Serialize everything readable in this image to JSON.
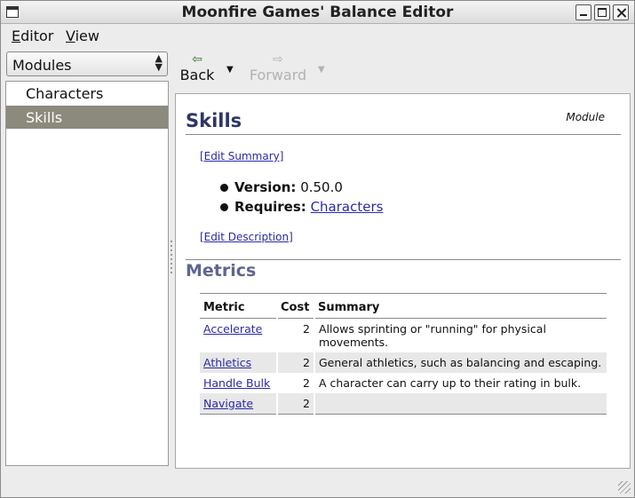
{
  "window": {
    "title": "Moonfire Games' Balance Editor"
  },
  "menubar": {
    "items": [
      {
        "label_u": "E",
        "label_rest": "ditor"
      },
      {
        "label_u": "V",
        "label_rest": "iew"
      }
    ]
  },
  "sidebar": {
    "select": {
      "value": "Modules"
    },
    "items": [
      {
        "label": "Characters",
        "selected": false
      },
      {
        "label": "Skills",
        "selected": true
      }
    ]
  },
  "toolbar": {
    "back_label": "Back",
    "forward_label": "Forward"
  },
  "page": {
    "title": "Skills",
    "tag": "Module",
    "edit_summary": "[Edit Summary]",
    "version_label": "Version:",
    "version_value": "0.50.0",
    "requires_label": "Requires:",
    "requires_value": "Characters",
    "edit_description": "[Edit Description]",
    "metrics_heading": "Metrics",
    "table": {
      "headers": [
        "Metric",
        "Cost",
        "Summary"
      ],
      "rows": [
        {
          "metric": "Accelerate",
          "cost": "2",
          "summary": "Allows sprinting or \"running\" for physical movements."
        },
        {
          "metric": "Athletics",
          "cost": "2",
          "summary": "General athletics, such as balancing and escaping."
        },
        {
          "metric": "Handle Bulk",
          "cost": "2",
          "summary": "A character can carry up to their rating in bulk."
        },
        {
          "metric": "Navigate",
          "cost": "2",
          "summary": ""
        }
      ]
    }
  }
}
